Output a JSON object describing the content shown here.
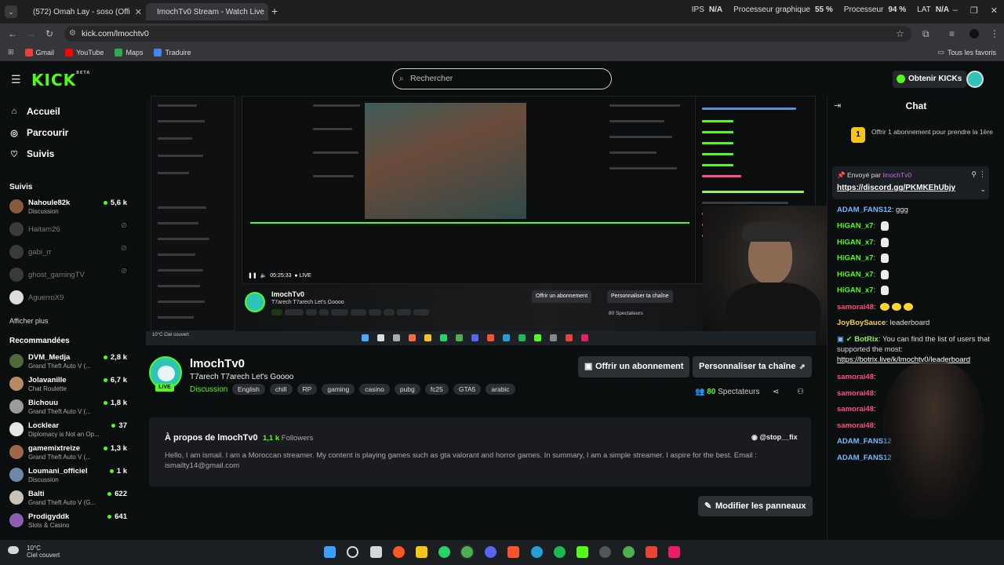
{
  "browser": {
    "tabs": [
      {
        "title": "(572) Omah Lay - soso (Offi",
        "active": false
      },
      {
        "title": "ImochTv0 Stream - Watch Live",
        "active": true
      }
    ],
    "stats": [
      {
        "label": "IPS",
        "value": "N/A"
      },
      {
        "label": "Processeur graphique",
        "value": "55 %"
      },
      {
        "label": "Processeur",
        "value": "94 %"
      },
      {
        "label": "LAT",
        "value": "N/A"
      }
    ],
    "url": "kick.com/lmochtv0",
    "bookmarks": [
      "Gmail",
      "YouTube",
      "Maps",
      "Traduire"
    ],
    "all_bookmarks": "Tous les favoris"
  },
  "header": {
    "logo": "KICK",
    "logo_tag": "BETA",
    "search_placeholder": "Rechercher",
    "get_kicks": "Obtenir KICKs"
  },
  "sidebar": {
    "nav": [
      "Accueil",
      "Parcourir",
      "Suivis"
    ],
    "followed_title": "Suivis",
    "followed": [
      {
        "name": "Nahoule82k",
        "game": "Discussion",
        "viewers": "5,6 k",
        "live": true
      },
      {
        "name": "Haitam26",
        "live": false
      },
      {
        "name": "gabi_rr",
        "live": false
      },
      {
        "name": "ghost_gamingTV",
        "live": false
      },
      {
        "name": "AguerroX9",
        "live": false
      }
    ],
    "show_more": "Afficher plus",
    "recommended_title": "Recommandées",
    "recommended": [
      {
        "name": "DVM_Medja",
        "game": "Grand Theft Auto V (...",
        "viewers": "2,8 k"
      },
      {
        "name": "Jolavanille",
        "game": "Chat Roulette",
        "viewers": "6,7 k"
      },
      {
        "name": "Bichouu",
        "game": "Grand Theft Auto V (...",
        "viewers": "1,8 k"
      },
      {
        "name": "Locklear",
        "game": "Diplomacy is Not an Op...",
        "viewers": "37"
      },
      {
        "name": "gamemixtreize",
        "game": "Grand Theft Auto V (...",
        "viewers": "1,3 k"
      },
      {
        "name": "Loumani_officiel",
        "game": "Discussion",
        "viewers": "1 k"
      },
      {
        "name": "Balti",
        "game": "Grand Theft Auto V (G...",
        "viewers": "622"
      },
      {
        "name": "Prodigyddk",
        "game": "Slots & Casino",
        "viewers": "641"
      }
    ]
  },
  "player": {
    "inner_channel": "lmochTv0",
    "inner_title": "T7arech T7arech Let's Goooo",
    "inner_time": "05:25:33",
    "inner_live": "LIVE",
    "inner_sub": "Offrir un abonnement",
    "inner_customize": "Personnaliser ta chaîne",
    "inner_viewers": "80 Spectateurs",
    "weather": "10°C Ciel couvert"
  },
  "channel": {
    "name": "lmochTv0",
    "live": "LIVE",
    "title": "T7arech T7arech Let's Goooo",
    "category": "Discussion",
    "tags": [
      "English",
      "chill",
      "RP",
      "gaming",
      "casino",
      "pubg",
      "fc25",
      "GTA5",
      "arabic"
    ],
    "subscribe_button": "Offrir un abonnement",
    "customize_button": "Personnaliser ta chaîne",
    "viewers_count": "80",
    "viewers_label": "Spectateurs"
  },
  "about": {
    "title": "À propos de lmochTv0",
    "followers_count": "1,1 k",
    "followers_label": "Followers",
    "discord": "@stop__fix",
    "description": "Hello, I am ismail. I am a Moroccan streamer. My content is playing games such as gta valorant and horror games. In summary, I am a simple streamer. I aspire for the best. Email : ismailty14@gmail.com",
    "edit_panels": "Modifier les panneaux"
  },
  "chat": {
    "title": "Chat",
    "promo": "Offrir 1 abonnement pour prendre la 1ère",
    "promo_count": "1",
    "pinned_by_label": "Envoyé par",
    "pinned_by": "lmochTv0",
    "pinned_link": "https://discord.gg/PKMKEhUbjy",
    "messages": [
      {
        "user": "ADAM_FANS12",
        "text": "ggg",
        "color": "blue"
      },
      {
        "user": "HiGAN_x7",
        "text": "",
        "color": "green",
        "emote": "skull"
      },
      {
        "user": "HiGAN_x7",
        "text": "",
        "color": "green",
        "emote": "skull"
      },
      {
        "user": "HiGAN_x7",
        "text": "",
        "color": "green",
        "emote": "skull"
      },
      {
        "user": "HiGAN_x7",
        "text": "",
        "color": "green",
        "emote": "skull"
      },
      {
        "user": "HiGAN_x7",
        "text": "",
        "color": "green",
        "emote": "skull"
      },
      {
        "user": "samorai48",
        "text": "",
        "color": "pink",
        "emote": "emoji"
      },
      {
        "user": "JoyBoySauce",
        "text": "leaderboard",
        "color": "yel"
      },
      {
        "user": "BotRix",
        "text": "You can find the list of users that",
        "color": "lime"
      },
      {
        "user": "",
        "text": "supported the most:",
        "color": ""
      },
      {
        "user": "",
        "text": "https://botrix.live/k/lmochtv0/leaderboard",
        "color": "link"
      },
      {
        "user": "samorai48",
        "text": "",
        "color": "pink"
      },
      {
        "user": "samorai48",
        "text": "",
        "color": "pink"
      },
      {
        "user": "samorai48",
        "text": "",
        "color": "pink"
      },
      {
        "user": "samorai48",
        "text": "",
        "color": "pink"
      },
      {
        "user": "ADAM_FANS12",
        "text": "",
        "color": "blue"
      },
      {
        "user": "ADAM_FANS12",
        "text": "",
        "color": "blue"
      }
    ]
  },
  "taskbar": {
    "temp": "10°C",
    "weather": "Ciel couvert"
  }
}
